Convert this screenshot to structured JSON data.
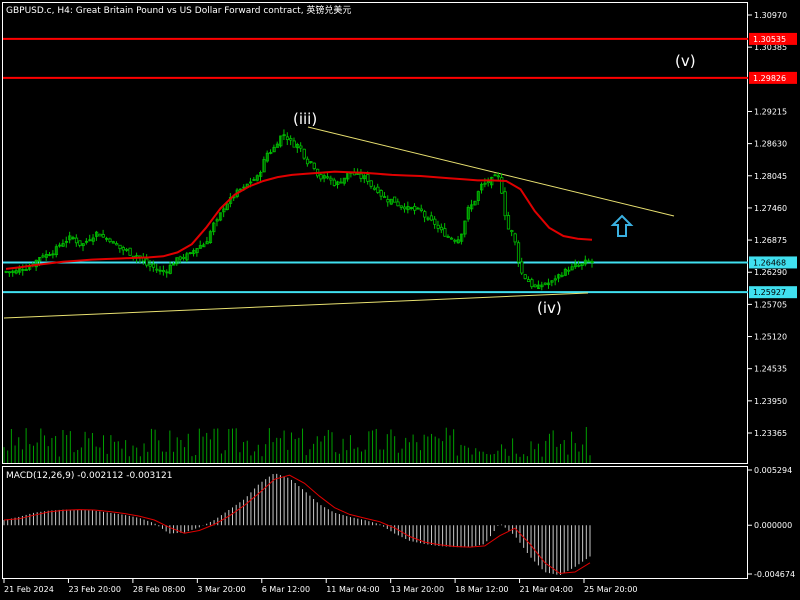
{
  "header": {
    "symbol_line": "GBPUSD.c, H4:  Great Britain Pound vs US Dollar Forward contract, 英镑兑美元"
  },
  "colors": {
    "background": "#000000",
    "frame": "#ffffff",
    "candle": "#00c000",
    "ma": "#e00000",
    "level_red": "#ff0000",
    "level_cyan": "#40e0f0",
    "trendline": "#e8e070",
    "arrow": "#3ab0e0",
    "macd_hist": "#c8c8c8",
    "macd_signal": "#e00000",
    "volume": "#00a000"
  },
  "price_axis": {
    "ticks": [
      "1.30970",
      "1.30385",
      "1.29215",
      "1.28630",
      "1.28045",
      "1.27460",
      "1.26875",
      "1.26290",
      "1.25705",
      "1.25120",
      "1.24535",
      "1.23950",
      "1.23365"
    ],
    "tick_values": [
      1.3097,
      1.30385,
      1.29215,
      1.2863,
      1.28045,
      1.2746,
      1.26875,
      1.2629,
      1.25705,
      1.2512,
      1.24535,
      1.2395,
      1.23365
    ],
    "range": [
      1.2295,
      1.3115
    ]
  },
  "levels": [
    {
      "price": 1.30535,
      "label": "1.30535",
      "kind": "red"
    },
    {
      "price": 1.29826,
      "label": "1.29826",
      "kind": "red"
    },
    {
      "price": 1.26468,
      "label": "1.26468",
      "kind": "cyan"
    },
    {
      "price": 1.25927,
      "label": "1.25927",
      "kind": "cyan"
    }
  ],
  "wave_labels": [
    {
      "text": "(iii)",
      "name": "wave-label-iii"
    },
    {
      "text": "(iv)",
      "name": "wave-label-iv"
    },
    {
      "text": "(v)",
      "name": "wave-label-v"
    }
  ],
  "macd": {
    "title": "MACD(12,26,9) -0.002112 -0.003121",
    "ticks": [
      "0.005294",
      "0.000000",
      "-0.004674"
    ],
    "tick_values": [
      0.005294,
      0.0,
      -0.004674
    ]
  },
  "time_axis": {
    "labels": [
      "21 Feb 2024",
      "23 Feb 20:00",
      "28 Feb 08:00",
      "3 Mar 20:00",
      "6 Mar 12:00",
      "11 Mar 04:00",
      "13 Mar 20:00",
      "18 Mar 12:00",
      "21 Mar 04:00",
      "25 Mar 20:00"
    ]
  },
  "chart_data": {
    "type": "candlestick",
    "series_ohlc_close_approx": [
      1.263,
      1.264,
      1.266,
      1.267,
      1.269,
      1.268,
      1.27,
      1.269,
      1.267,
      1.266,
      1.264,
      1.263,
      1.265,
      1.266,
      1.268,
      1.272,
      1.276,
      1.278,
      1.28,
      1.285,
      1.288,
      1.286,
      1.283,
      1.28,
      1.279,
      1.281,
      1.28,
      1.278,
      1.276,
      1.275,
      1.274,
      1.272,
      1.27,
      1.269,
      1.275,
      1.279,
      1.28,
      1.27,
      1.262,
      1.26,
      1.261,
      1.263,
      1.264,
      1.2647
    ],
    "moving_average_approx": [
      1.2635,
      1.2638,
      1.2642,
      1.2645,
      1.2648,
      1.265,
      1.2652,
      1.2653,
      1.2654,
      1.2655,
      1.2656,
      1.2658,
      1.2665,
      1.268,
      1.271,
      1.2745,
      1.277,
      1.2785,
      1.2795,
      1.2802,
      1.2806,
      1.2808,
      1.281,
      1.2812,
      1.2811,
      1.281,
      1.2808,
      1.2806,
      1.2805,
      1.2804,
      1.2802,
      1.28,
      1.2798,
      1.2796,
      1.2796,
      1.2795,
      1.278,
      1.274,
      1.271,
      1.2695,
      1.269,
      1.2688
    ],
    "macd_histogram_approx": [
      0.0005,
      0.0008,
      0.0012,
      0.0014,
      0.0015,
      0.0015,
      0.0014,
      0.0012,
      0.001,
      0.0007,
      0.0002,
      -0.0008,
      -0.0007,
      -0.0002,
      0.0005,
      0.0015,
      0.0025,
      0.004,
      0.005,
      0.0045,
      0.0033,
      0.002,
      0.0012,
      0.0008,
      0.0005,
      0.0001,
      -0.0008,
      -0.0015,
      -0.0018,
      -0.002,
      -0.0021,
      -0.0021,
      -0.0018,
      0.0002,
      -0.001,
      -0.003,
      -0.0045,
      -0.0048,
      -0.004,
      -0.003
    ]
  }
}
